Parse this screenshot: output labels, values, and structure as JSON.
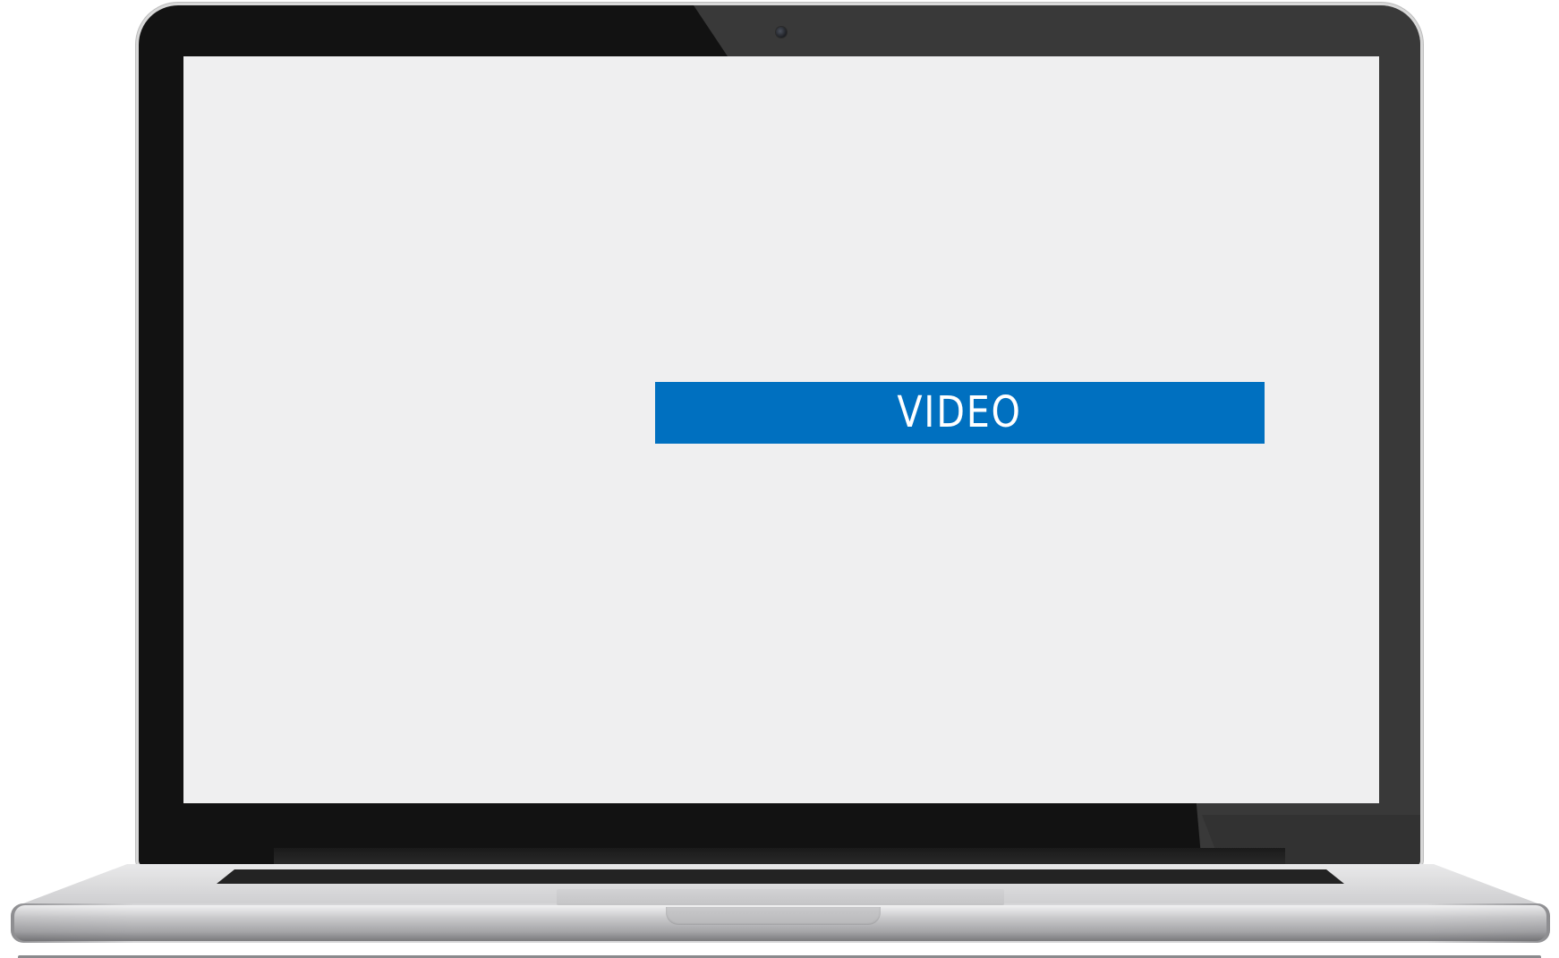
{
  "device": {
    "type": "laptop mockup",
    "bezel_color": "#121212",
    "screen_background": "#efeff0"
  },
  "screen": {
    "banner": {
      "label": "VIDEO",
      "background": "#0070c0",
      "text_color": "#ffffff"
    }
  },
  "icons": {
    "camera": "webcam-icon"
  }
}
